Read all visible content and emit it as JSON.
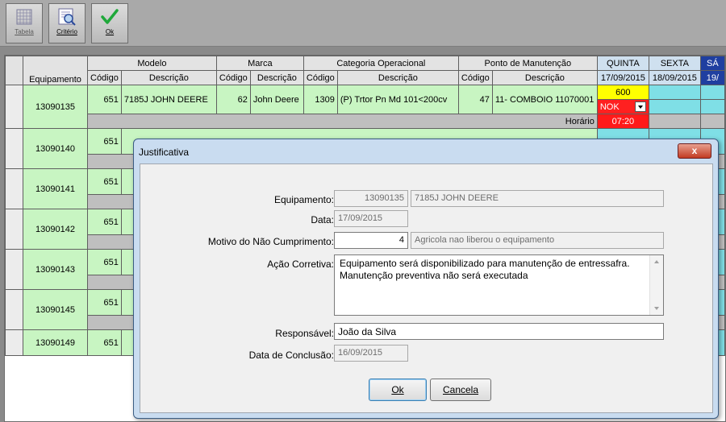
{
  "toolbar": {
    "buttons": [
      {
        "label": "Tabela",
        "icon": "table-icon"
      },
      {
        "label": "Critério",
        "icon": "search-icon"
      },
      {
        "label": "Ok",
        "icon": "checkmark-icon"
      }
    ]
  },
  "grid": {
    "headers": {
      "equipamento": "Equipamento",
      "modelo": "Modelo",
      "marca": "Marca",
      "categoria": "Categoria Operacional",
      "ponto": "Ponto de Manutenção",
      "codigo": "Código",
      "descricao": "Descrição",
      "days": [
        {
          "name": "QUINTA",
          "date": "17/09/2015"
        },
        {
          "name": "SEXTA",
          "date": "18/09/2015"
        },
        {
          "name": "SÁ",
          "date": "19/"
        }
      ]
    },
    "first_row": {
      "equipamento": "13090135",
      "modelo_cod": "651",
      "modelo_desc": "7185J JOHN DEERE",
      "marca_cod": "62",
      "marca_desc": "John Deere",
      "cat_cod": "1309",
      "cat_desc": "(P) Trtor Pn Md 101<200cv",
      "ponto_cod": "47",
      "ponto_desc": "11- COMBOIO 11070001",
      "value": "600",
      "status": "NOK",
      "horario_label": "Horário",
      "horario_value": "07:20"
    },
    "rows": [
      {
        "equipamento": "13090140",
        "modelo_cod": "651"
      },
      {
        "equipamento": "13090141",
        "modelo_cod": "651"
      },
      {
        "equipamento": "13090142",
        "modelo_cod": "651"
      },
      {
        "equipamento": "13090143",
        "modelo_cod": "651"
      },
      {
        "equipamento": "13090145",
        "modelo_cod": "651"
      },
      {
        "equipamento": "13090149",
        "modelo_cod": "651"
      }
    ]
  },
  "dialog": {
    "title": "Justificativa",
    "close": "x",
    "equipamento_label": "Equipamento:",
    "equipamento_code": "13090135",
    "equipamento_desc": "7185J JOHN DEERE",
    "data_label": "Data:",
    "data_value": "17/09/2015",
    "motivo_label": "Motivo do Não Cumprimento:",
    "motivo_code": "4",
    "motivo_desc": "Agricola nao liberou o equipamento",
    "acao_label": "Ação Corretiva:",
    "acao_line1": "Equipamento será disponibilizado para manutenção de entressafra.",
    "acao_line2": "Manutenção preventiva não será executada",
    "responsavel_label": "Responsável:",
    "responsavel_value": "João da Silva",
    "conclusao_label": "Data de Conclusão:",
    "conclusao_value": "16/09/2015",
    "ok_label": "Ok",
    "cancel_label": "Cancela"
  }
}
